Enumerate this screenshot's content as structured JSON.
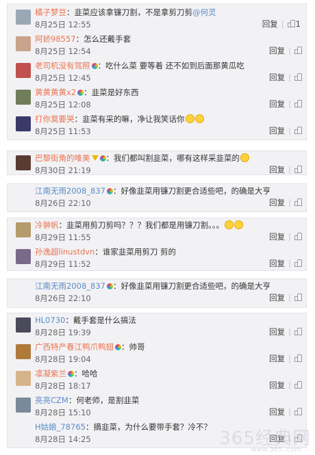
{
  "labels": {
    "reply": "回复"
  },
  "blocks": [
    {
      "comments": [
        {
          "user": "橘子梦豆",
          "vip": false,
          "text": "：韭菜应该拿镰刀割，不是拿剪刀剪",
          "mention": "@何灵",
          "time": "8月25日 12:55",
          "likes": "1",
          "avatar_color": "#9aa7b5"
        },
        {
          "user": "阿娇98557",
          "vip": false,
          "text": "：怎么还戴手套",
          "time": "8月25日 12:54",
          "likes": "",
          "avatar_color": "#c9a48a"
        },
        {
          "user": "老司机没有驾照",
          "vip": true,
          "text": "：吃什么菜 要等着 还不如到后面那黄瓜吃",
          "time": "8月25日 12:45",
          "likes": "",
          "avatar_color": "#c0504d"
        },
        {
          "user": "黄黄黄黄x2",
          "vip": true,
          "text": "：韭菜是好东西",
          "time": "8月25日 12:08",
          "likes": "",
          "avatar_color": "#6f7d5a"
        },
        {
          "user": "打你莫要哭",
          "vip": false,
          "text": "：韭菜有采的嘛，净让我笑话你",
          "emoji": 2,
          "time": "8月25日 11:53",
          "likes": "",
          "avatar_color": "#3a3a6a"
        }
      ]
    },
    {
      "comments": [
        {
          "user": "巴黎街角的唯美",
          "vip": true,
          "crown": true,
          "text": "：我们都叫割韭菜，哪有这样采韭菜的",
          "emoji": 1,
          "time": "8月30日 21:19",
          "likes": "",
          "avatar_color": "#5a3b32"
        }
      ]
    },
    {
      "comments": [
        {
          "user": "江南无雨2008_837",
          "vip": true,
          "text": "：好像韭菜用镰刀割更合适些吧，的确是大亨",
          "time": "8月26日 22:10",
          "likes": "",
          "avatar_color": ""
        }
      ]
    },
    {
      "comments": [
        {
          "user": "冷翀帆",
          "vip": false,
          "text": "：韭菜用剪刀剪吗？？？我们都是用镰刀割。。。",
          "emoji": 2,
          "time": "8月29日 11:55",
          "likes": "",
          "avatar_color": "#b59a6a"
        },
        {
          "user": "孙逸超linustdvn",
          "vip": false,
          "text": "：谁家韭菜用剪刀 剪的",
          "time": "8月29日 11:52",
          "likes": "",
          "avatar_color": "#7a6a8a"
        }
      ]
    },
    {
      "comments": [
        {
          "user": "江南无雨2008_837",
          "vip": true,
          "text": "：好像韭菜用镰刀割更合适些吧，的确是大亨",
          "time": "8月26日 22:10",
          "likes": "",
          "avatar_color": ""
        }
      ]
    },
    {
      "comments": [
        {
          "user": "HL0730",
          "vip": false,
          "text": "：戴手套是什么搞法",
          "time": "8月28日 19:39",
          "likes": "",
          "avatar_color": "#4a4a5a"
        },
        {
          "user": "广西特产春江鸭爪鸭翅",
          "vip": true,
          "text": "：帅哥",
          "time": "8月28日 19:04",
          "likes": "",
          "avatar_color": "#b07a3a"
        },
        {
          "user": "凛凝紫兰",
          "vip": true,
          "text": "：哈哈",
          "time": "8月28日 18:17",
          "likes": "",
          "avatar_color": "#d6b48a"
        },
        {
          "user": "亮亮CZM",
          "vip": false,
          "text": "：何老师，是割韭菜",
          "time": "8月28日 15:10",
          "likes": "",
          "avatar_color": "#7a8a9a"
        },
        {
          "user": "H姑娘_78765",
          "vip": false,
          "text": "：摘韭菜，为什么要带手套？冷不？",
          "time": "8月28日 14:25",
          "likes": "",
          "avatar_color": ""
        }
      ]
    }
  ],
  "watermark": {
    "text": "365经典网",
    "url": "www.365..com"
  }
}
